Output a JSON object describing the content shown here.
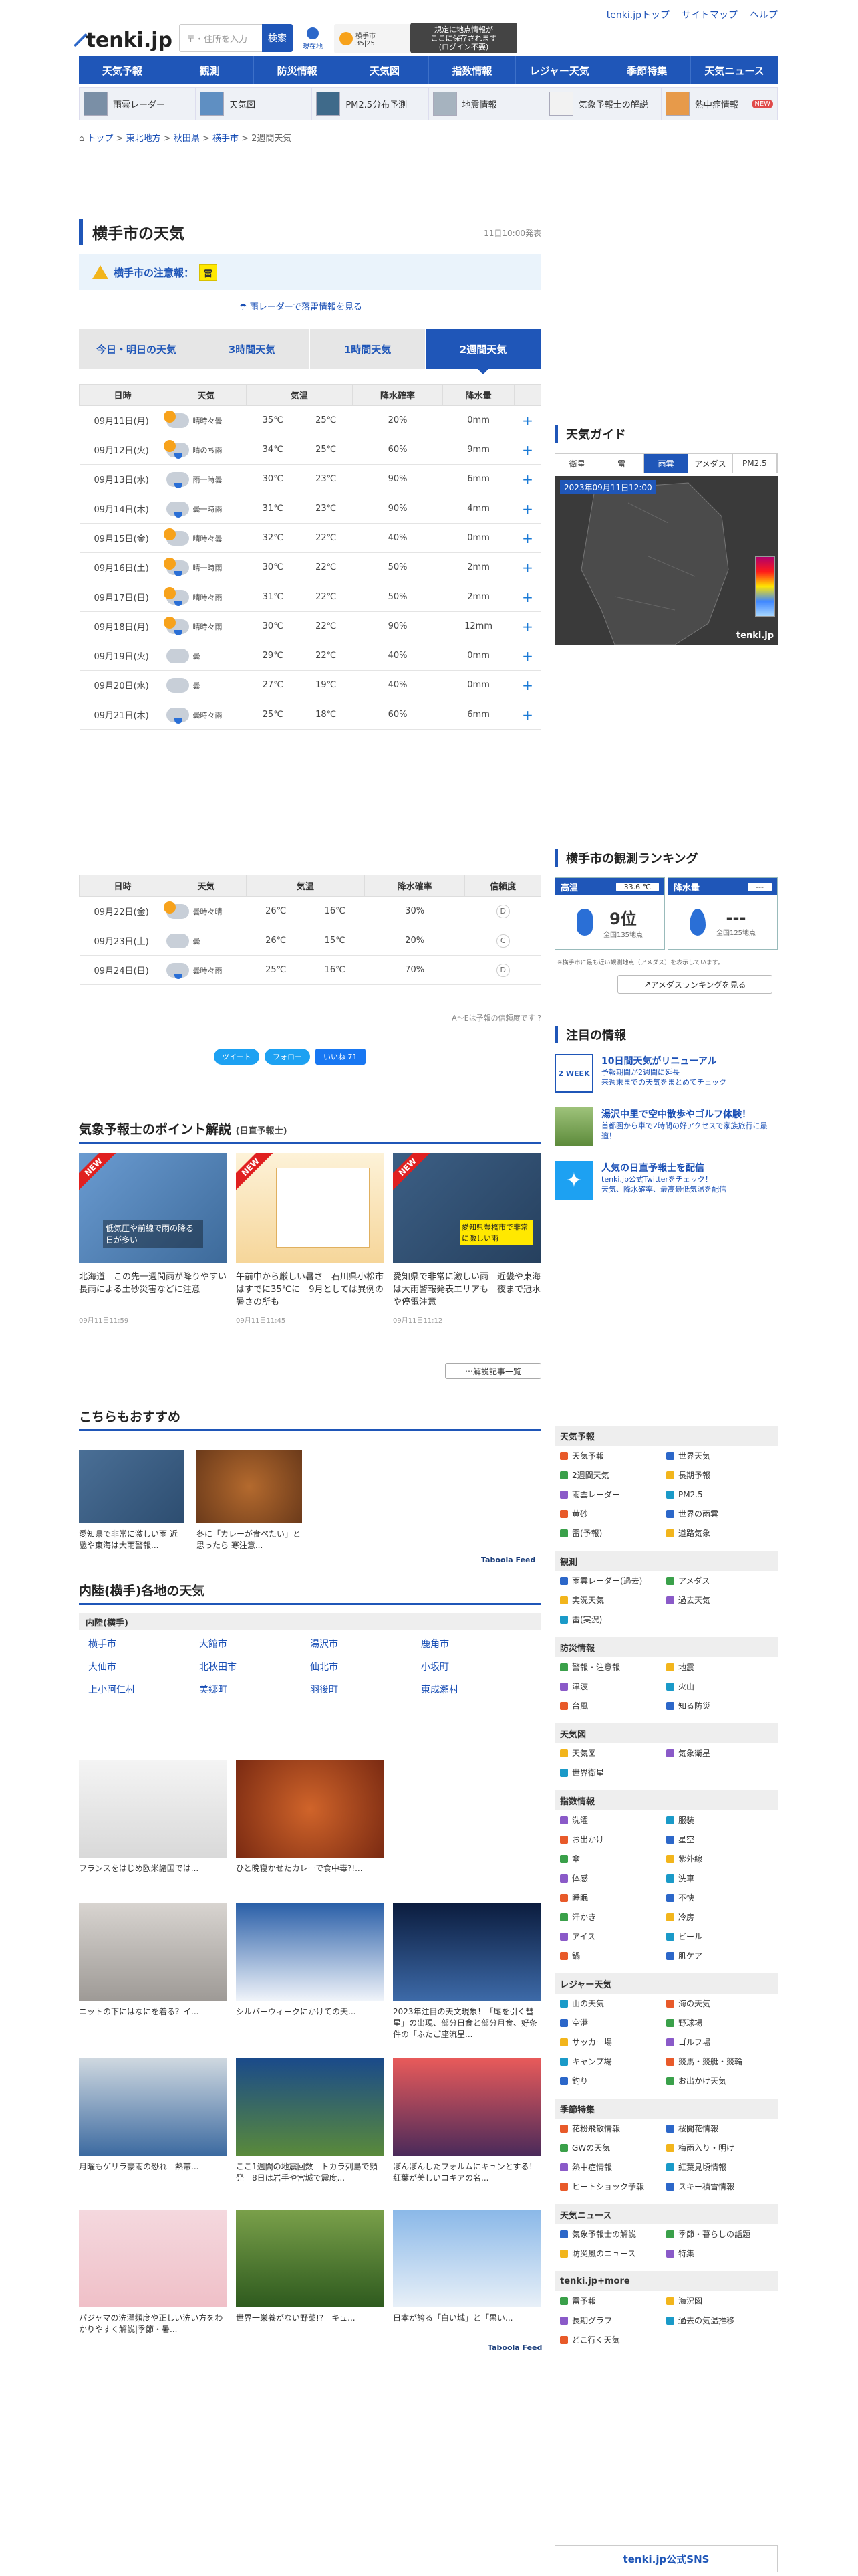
{
  "header": {
    "logo_text": "tenki.jp",
    "search_placeholder": "〒・住所を入力",
    "search_button": "検索",
    "current_location": "現在地",
    "mini_weather": {
      "label": "横手市",
      "temps": "35|25"
    },
    "tooltip": "規定に地点情報が\nここに保存されます\n(ログイン不要)",
    "top_links": [
      "tenki.jpトップ",
      "サイトマップ",
      "ヘルプ"
    ]
  },
  "nav": [
    "天気予報",
    "観測",
    "防災情報",
    "天気図",
    "指数情報",
    "レジャー天気",
    "季節特集",
    "天気ニュース"
  ],
  "subnav": [
    "雨雲レーダー",
    "天気図",
    "PM2.5分布予測",
    "地震情報",
    "気象予報士の解説",
    "熱中症情報"
  ],
  "subnav_badge": "NEW",
  "breadcrumb": [
    "トップ",
    "東北地方",
    "秋田県",
    "横手市",
    "2週間天気"
  ],
  "main": {
    "title": "横手市の天気",
    "issued": "11日10:00発表",
    "warning_label": "横手市の注意報：",
    "warning_chip": "雷",
    "radar_link": "雨レーダーで落雷情報を見る",
    "tabs": [
      "今日・明日の天気",
      "3時間天気",
      "1時間天気",
      "2週間天気"
    ]
  },
  "table1": {
    "headers": [
      "日時",
      "天気",
      "気温",
      "降水確率",
      "降水量"
    ],
    "rows": [
      {
        "date": "09月11日(月)",
        "wx": "晴時々曇",
        "icon": "s",
        "hi": "35℃",
        "lo": "25℃",
        "pop": "20%",
        "amt": "0mm",
        "day": ""
      },
      {
        "date": "09月12日(火)",
        "wx": "晴のち雨",
        "icon": "sr",
        "hi": "34℃",
        "lo": "25℃",
        "pop": "60%",
        "amt": "9mm",
        "day": ""
      },
      {
        "date": "09月13日(水)",
        "wx": "雨一時曇",
        "icon": "r",
        "hi": "30℃",
        "lo": "23℃",
        "pop": "90%",
        "amt": "6mm",
        "day": ""
      },
      {
        "date": "09月14日(木)",
        "wx": "曇一時雨",
        "icon": "r",
        "hi": "31℃",
        "lo": "23℃",
        "pop": "90%",
        "amt": "4mm",
        "day": ""
      },
      {
        "date": "09月15日(金)",
        "wx": "晴時々曇",
        "icon": "s",
        "hi": "32℃",
        "lo": "22℃",
        "pop": "40%",
        "amt": "0mm",
        "day": ""
      },
      {
        "date": "09月16日(土)",
        "wx": "晴一時雨",
        "icon": "sr",
        "hi": "30℃",
        "lo": "22℃",
        "pop": "50%",
        "amt": "2mm",
        "day": "sat"
      },
      {
        "date": "09月17日(日)",
        "wx": "晴時々雨",
        "icon": "sr",
        "hi": "31℃",
        "lo": "22℃",
        "pop": "50%",
        "amt": "2mm",
        "day": "sun"
      },
      {
        "date": "09月18日(月)",
        "wx": "晴時々雨",
        "icon": "sr",
        "hi": "30℃",
        "lo": "22℃",
        "pop": "90%",
        "amt": "12mm",
        "day": "sun"
      },
      {
        "date": "09月19日(火)",
        "wx": "曇",
        "icon": "c",
        "hi": "29℃",
        "lo": "22℃",
        "pop": "40%",
        "amt": "0mm",
        "day": ""
      },
      {
        "date": "09月20日(水)",
        "wx": "曇",
        "icon": "c",
        "hi": "27℃",
        "lo": "19℃",
        "pop": "40%",
        "amt": "0mm",
        "day": ""
      },
      {
        "date": "09月21日(木)",
        "wx": "曇時々雨",
        "icon": "r",
        "hi": "25℃",
        "lo": "18℃",
        "pop": "60%",
        "amt": "6mm",
        "day": ""
      }
    ]
  },
  "table2": {
    "headers": [
      "日時",
      "天気",
      "気温",
      "降水確率",
      "信頼度"
    ],
    "rows": [
      {
        "date": "09月22日(金)",
        "wx": "曇時々晴",
        "icon": "s",
        "hi": "26℃",
        "lo": "16℃",
        "pop": "30%",
        "rel": "D",
        "day": ""
      },
      {
        "date": "09月23日(土)",
        "wx": "曇",
        "icon": "c",
        "hi": "26℃",
        "lo": "15℃",
        "pop": "20%",
        "rel": "C",
        "day": "sat"
      },
      {
        "date": "09月24日(日)",
        "wx": "曇時々雨",
        "icon": "r",
        "hi": "25℃",
        "lo": "16℃",
        "pop": "70%",
        "rel": "D",
        "day": "sun"
      }
    ]
  },
  "reliability_note": "A〜Eは予報の信頼度です",
  "share": {
    "tweet": "ツイート",
    "follow": "フォロー",
    "like": "いいね 71"
  },
  "point": {
    "title": "気象予報士のポイント解説",
    "subtitle": "(日直予報士)",
    "cards": [
      {
        "text": "北海道　この先一週間雨が降りやすい　長雨による土砂災害などに注意",
        "time": "09月11日11:59",
        "badge": "NEW",
        "overlay": "低気圧や前線で雨の降る日が多い"
      },
      {
        "text": "午前中から厳しい暑さ　石川県小松市はすでに35℃に　9月としては異例の暑さの所も",
        "time": "09月11日11:45",
        "badge": "NEW",
        "overlay": ""
      },
      {
        "text": "愛知県で非常に激しい雨　近畿や東海は大雨警報発表エリアも　夜まで冠水や停電注意",
        "time": "09月11日11:12",
        "badge": "NEW",
        "overlay": "愛知県豊橋市で非常に激しい雨"
      }
    ],
    "more": "解説記事一覧"
  },
  "recommend": {
    "title": "こちらもおすすめ",
    "cards": [
      {
        "text": "愛知県で非常に激しい雨 近畿や東海は大雨警報..."
      },
      {
        "text": "冬に「カレーが食べたい」と思ったら 寒注意..."
      }
    ],
    "feed": "Taboola Feed"
  },
  "region": {
    "title": "内陸(横手)各地の天気",
    "head": "内陸(横手)",
    "cities": [
      "横手市",
      "大館市",
      "湯沢市",
      "鹿角市",
      "大仙市",
      "北秋田市",
      "仙北市",
      "小坂町",
      "上小阿仁村",
      "美郷町",
      "羽後町",
      "東成瀬村"
    ]
  },
  "ads": [
    {
      "text": "フランスをはじめ欧米諸国では..."
    },
    {
      "text": "ひと晩寝かせたカレーで食中毒?!..."
    },
    {
      "text": "ニットの下にはなにを着る？イ..."
    },
    {
      "text": "シルバーウィークにかけての天..."
    },
    {
      "text": "2023年注目の天文現象！「尾を引く彗星」の出現、部分日食と部分月食、好条件の「ふたご座流星..."
    },
    {
      "text": "月曜もゲリラ豪雨の恐れ　熱帯..."
    },
    {
      "text": "ここ1週間の地震回数　トカラ列島で頻発　8日は岩手や宮城で震度..."
    },
    {
      "text": "ぽんぽんしたフォルムにキュンとする！紅葉が美しいコキアの名..."
    },
    {
      "text": "パジャマの洗濯頻度や正しい洗い方をわかりやすく解説|季節・暑..."
    },
    {
      "text": "世界一栄養がない野菜!?　キュ..."
    },
    {
      "text": "日本が誇る「白い城」と「黒い..."
    }
  ],
  "ads_feed": "Taboola Feed",
  "guide": {
    "title": "天気ガイド",
    "tabs": [
      "衛星",
      "雷",
      "雨雲",
      "アメダス",
      "PM2.5"
    ],
    "active_tab": 2,
    "stamp": "2023年09月11日12:00",
    "brand": "tenki.jp"
  },
  "ranking": {
    "title": "横手市の観測ランキング",
    "high_label": "高温",
    "high_value": "33.6 ℃",
    "high_rank": "9位",
    "high_total": "全国135地点",
    "rain_label": "降水量",
    "rain_value": "---",
    "rain_rank": "---",
    "rain_total": "全国125地点",
    "note": "※横手市に最も近い観測地点（アメダス）を表示しています。",
    "button": "アメダスランキングを見る"
  },
  "notice": {
    "title": "注目の情報",
    "items": [
      {
        "title": "10日間天気がリニューアル",
        "desc": "予報期間が2週間に延長\n来週末までの天気をまとめてチェック",
        "icon": "2 WEEK"
      },
      {
        "title": "湯沢中里で空中散歩やゴルフ体験！",
        "desc": "首都圏から車で2時間の好アクセスで家族旅行に最適！",
        "icon": ""
      },
      {
        "title": "人気の日直予報士を配信",
        "desc": "tenki.jp公式Twitterをチェック！\n天気、降水確率、最高最低気温を配信",
        "icon": ""
      }
    ]
  },
  "side_nav": [
    {
      "head": "天気予報",
      "items": [
        "天気予報",
        "世界天気",
        "2週間天気",
        "長期予報",
        "雨雲レーダー",
        "PM2.5",
        "黄砂",
        "世界の雨雲",
        "雷(予報)",
        "道路気象"
      ]
    },
    {
      "head": "観測",
      "items": [
        "雨雲レーダー(過去)",
        "アメダス",
        "実況天気",
        "過去天気",
        "雷(実況)"
      ]
    },
    {
      "head": "防災情報",
      "items": [
        "警報・注意報",
        "地震",
        "津波",
        "火山",
        "台風",
        "知る防災"
      ]
    },
    {
      "head": "天気図",
      "items": [
        "天気図",
        "気象衛星",
        "世界衛星"
      ]
    },
    {
      "head": "指数情報",
      "items": [
        "洗濯",
        "服装",
        "お出かけ",
        "星空",
        "傘",
        "紫外線",
        "体感",
        "洗車",
        "睡眠",
        "不快",
        "汗かき",
        "冷房",
        "アイス",
        "ビール",
        "鍋",
        "肌ケア"
      ]
    },
    {
      "head": "レジャー天気",
      "items": [
        "山の天気",
        "海の天気",
        "空港",
        "野球場",
        "サッカー場",
        "ゴルフ場",
        "キャンプ場",
        "競馬・競艇・競輪",
        "釣り",
        "お出かけ天気"
      ]
    },
    {
      "head": "季節特集",
      "items": [
        "花粉飛散情報",
        "桜開花情報",
        "GWの天気",
        "梅雨入り・明け",
        "熱中症情報",
        "紅葉見頃情報",
        "ヒートショック予報",
        "スキー積雪情報"
      ]
    },
    {
      "head": "天気ニュース",
      "items": [
        "気象予報士の解説",
        "季節・暮らしの話題",
        "防災風のニュース",
        "特集"
      ]
    },
    {
      "head": "tenki.jp+more",
      "items": [
        "雷予報",
        "海況図",
        "長期グラフ",
        "過去の気温推移",
        "どこ行く天気"
      ]
    }
  ],
  "sns_title": "tenki.jp公式SNS"
}
